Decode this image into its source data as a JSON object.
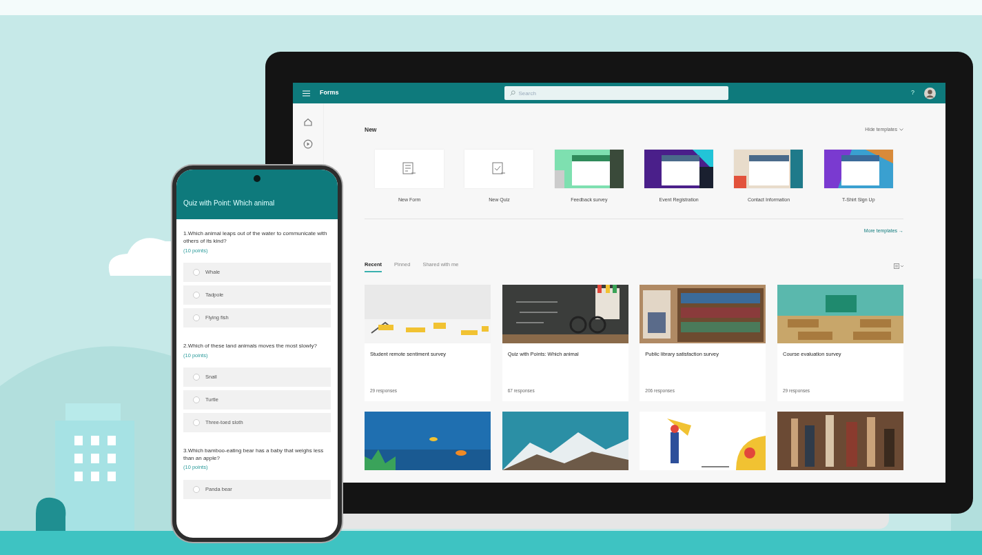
{
  "laptop": {
    "app_title": "Forms",
    "search": {
      "placeholder": "Search"
    },
    "help": "?",
    "new_section": {
      "title": "New",
      "hide_link": "Hide templates",
      "templates": [
        {
          "label": "New Form",
          "kind": "blank_form"
        },
        {
          "label": "New Quiz",
          "kind": "blank_quiz"
        },
        {
          "label": "Feedback survey",
          "kind": "template"
        },
        {
          "label": "Event Registration",
          "kind": "template"
        },
        {
          "label": "Contact Information",
          "kind": "template"
        },
        {
          "label": "T-Shirt Sign Up",
          "kind": "template"
        }
      ],
      "more_link": "More templates →"
    },
    "tabs": [
      {
        "label": "Recent",
        "selected": true
      },
      {
        "label": "Pinned",
        "selected": false
      },
      {
        "label": "Shared with me",
        "selected": false
      }
    ],
    "forms": [
      {
        "title": "Student remote sentiment survey",
        "responses": "29 responses"
      },
      {
        "title": "Quiz with Points: Which animal",
        "responses": "67 responses"
      },
      {
        "title": "Public library satisfaction survey",
        "responses": "206 responses"
      },
      {
        "title": "Course evaluation survey",
        "responses": "29 responses"
      }
    ]
  },
  "phone": {
    "title": "Quiz with Point: Which animal",
    "questions": [
      {
        "text": "1.Which animal leaps out of the water to communicate with others of its kind?",
        "points": "(10 points)",
        "options": [
          {
            "label": "Whale",
            "selected": false
          },
          {
            "label": "Tadpole",
            "selected": false
          },
          {
            "label": "Flying fish",
            "selected": false
          }
        ]
      },
      {
        "text": "2.Which of these land animals moves the most slowly?",
        "points": "(10 points)",
        "options": [
          {
            "label": "Snail",
            "selected": false
          },
          {
            "label": "Turtle",
            "selected": false
          },
          {
            "label": "Three-toed sloth",
            "selected": false
          }
        ]
      },
      {
        "text": "3.Which bamboo-eating bear has a baby that weighs less than an apple?",
        "points": "(10 points)",
        "options": [
          {
            "label": "Panda bear",
            "selected": false
          }
        ]
      }
    ]
  }
}
